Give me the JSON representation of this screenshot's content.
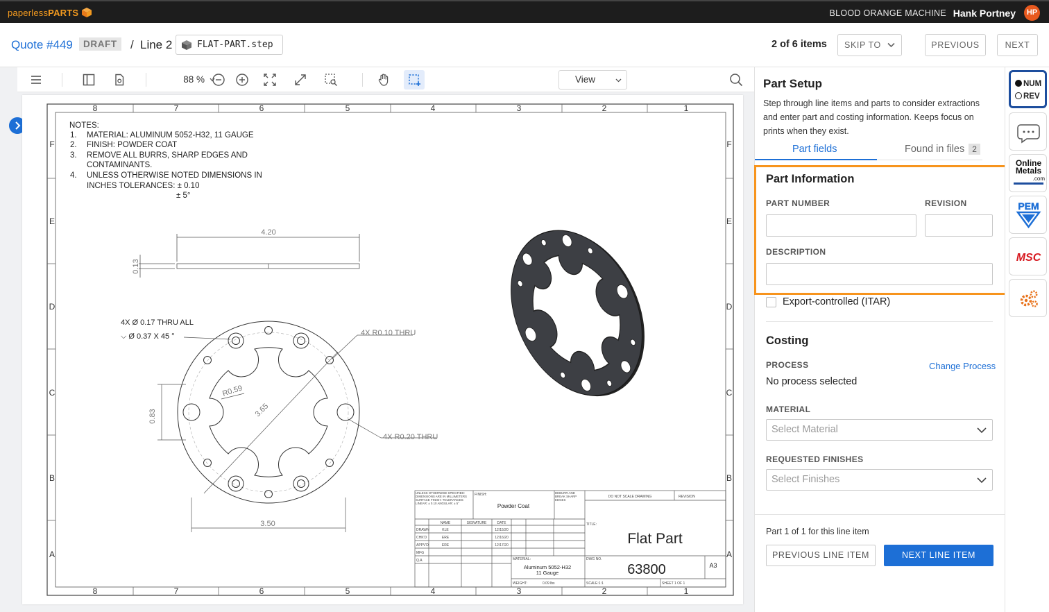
{
  "brand": {
    "part1": "paperless",
    "part2": "PARTS"
  },
  "header": {
    "company": "BLOOD ORANGE MACHINE",
    "user_name": "Hank Portney",
    "user_initials": "HP"
  },
  "breadcrumb": {
    "quote": "Quote #449",
    "status": "DRAFT",
    "separator": "/",
    "line": "Line 2",
    "file": "FLAT-PART.step"
  },
  "pager": {
    "count": "2 of 6 items",
    "skip_to": "SKIP TO",
    "previous": "PREVIOUS",
    "next": "NEXT"
  },
  "toolbar": {
    "zoom": "88 %",
    "view": "View"
  },
  "drawing": {
    "zone_numbers": [
      "8",
      "7",
      "6",
      "5",
      "4",
      "3",
      "2",
      "1"
    ],
    "zone_letters": [
      "F",
      "E",
      "D",
      "C",
      "B",
      "A"
    ],
    "notes_heading": "NOTES:",
    "notes": [
      {
        "n": "1.",
        "text": "MATERIAL: ALUMINUM 5052-H32, 11 GAUGE"
      },
      {
        "n": "2.",
        "text": "FINISH: POWDER COAT"
      },
      {
        "n": "3.",
        "text": "REMOVE ALL BURRS, SHARP EDGES AND"
      },
      {
        "n": "",
        "text": "CONTAMINANTS."
      },
      {
        "n": "4.",
        "text": "UNLESS OTHERWISE NOTED DIMENSIONS IN"
      },
      {
        "n": "",
        "text": "INCHES TOLERANCES: ± 0.10"
      },
      {
        "n": "",
        "text": "± 5°"
      }
    ],
    "dims": {
      "length": "4.20",
      "thickness": "0.13",
      "hole_callout_1": "4X Ø 0.17 THRU ALL",
      "hole_callout_2": "⌵ Ø 0.37 X 45 °",
      "radius_small": "4X R0.10 THRU",
      "radius_large": "4X R0.20 THRU",
      "inner_radius": "R0.59",
      "inner_dia": "3.65",
      "offset": "0.83",
      "width": "3.50"
    },
    "title_block": {
      "general_tol": "UNLESS OTHERWISE SPECIFIED: DIMENSIONS ARE IN MILLIMETERS SURFACE FINISH: TOLERANCES: LINEAR: ± 0.10 ANGULAR: ± 5°",
      "finish_label": "FINISH:",
      "finish": "Powder Coat",
      "deburr": "DEBURR AND BREAK SHARP EDGES",
      "no_scale": "DO NOT SCALE DRAWING",
      "revision": "REVISION",
      "name_hdr": "NAME",
      "sig_hdr": "SIGNATURE",
      "date_hdr": "DATE",
      "rows": [
        {
          "role": "DRAWN",
          "name": "KLE",
          "date": "12/15/20"
        },
        {
          "role": "CHK'D",
          "name": "ERE",
          "date": "12/16/20"
        },
        {
          "role": "APPV'D",
          "name": "ERE",
          "date": "12/17/20"
        },
        {
          "role": "MFG",
          "name": "",
          "date": ""
        },
        {
          "role": "Q.A",
          "name": "",
          "date": ""
        }
      ],
      "title_label": "TITLE:",
      "title": "Flat Part",
      "material_label": "MATERIAL:",
      "material_line1": "Aluminum 5052-H32",
      "material_line2": "11 Gauge",
      "dwg_label": "DWG NO.",
      "dwg_no": "63800",
      "size": "A3",
      "weight_label": "WEIGHT:",
      "weight": "0.09 lbs",
      "scale": "SCALE:1:1",
      "sheet": "SHEET 1 OF 1"
    }
  },
  "panel": {
    "title": "Part Setup",
    "description": "Step through line items and parts to consider extractions and enter part and costing information. Keeps focus on prints when they exist.",
    "tabs": {
      "fields": "Part fields",
      "files": "Found in files",
      "files_count": "2"
    },
    "part_info": {
      "title": "Part Information",
      "part_number_label": "PART NUMBER",
      "revision_label": "REVISION",
      "description_label": "DESCRIPTION"
    },
    "itar_label": "Export-controlled (ITAR)",
    "costing": {
      "title": "Costing",
      "process_label": "PROCESS",
      "change_process": "Change Process",
      "process_value": "No process selected",
      "material_label": "MATERIAL",
      "material_placeholder": "Select Material",
      "finishes_label": "REQUESTED FINISHES",
      "finishes_placeholder": "Select Finishes"
    },
    "footer": {
      "count": "Part 1 of 1 for this line item",
      "prev_line": "PREVIOUS LINE ITEM",
      "next_line": "NEXT LINE ITEM"
    }
  },
  "rail": {
    "num": "NUM",
    "rev": "REV",
    "online_metals_1": "Online",
    "online_metals_2": "Metals",
    "online_metals_3": ".com",
    "pem": "PEM",
    "msc": "MSC"
  },
  "colors": {
    "accent": "#1d6fd6",
    "highlight": "#f7941d",
    "brand_orange": "#f39a1f",
    "avatar": "#e8591e"
  }
}
